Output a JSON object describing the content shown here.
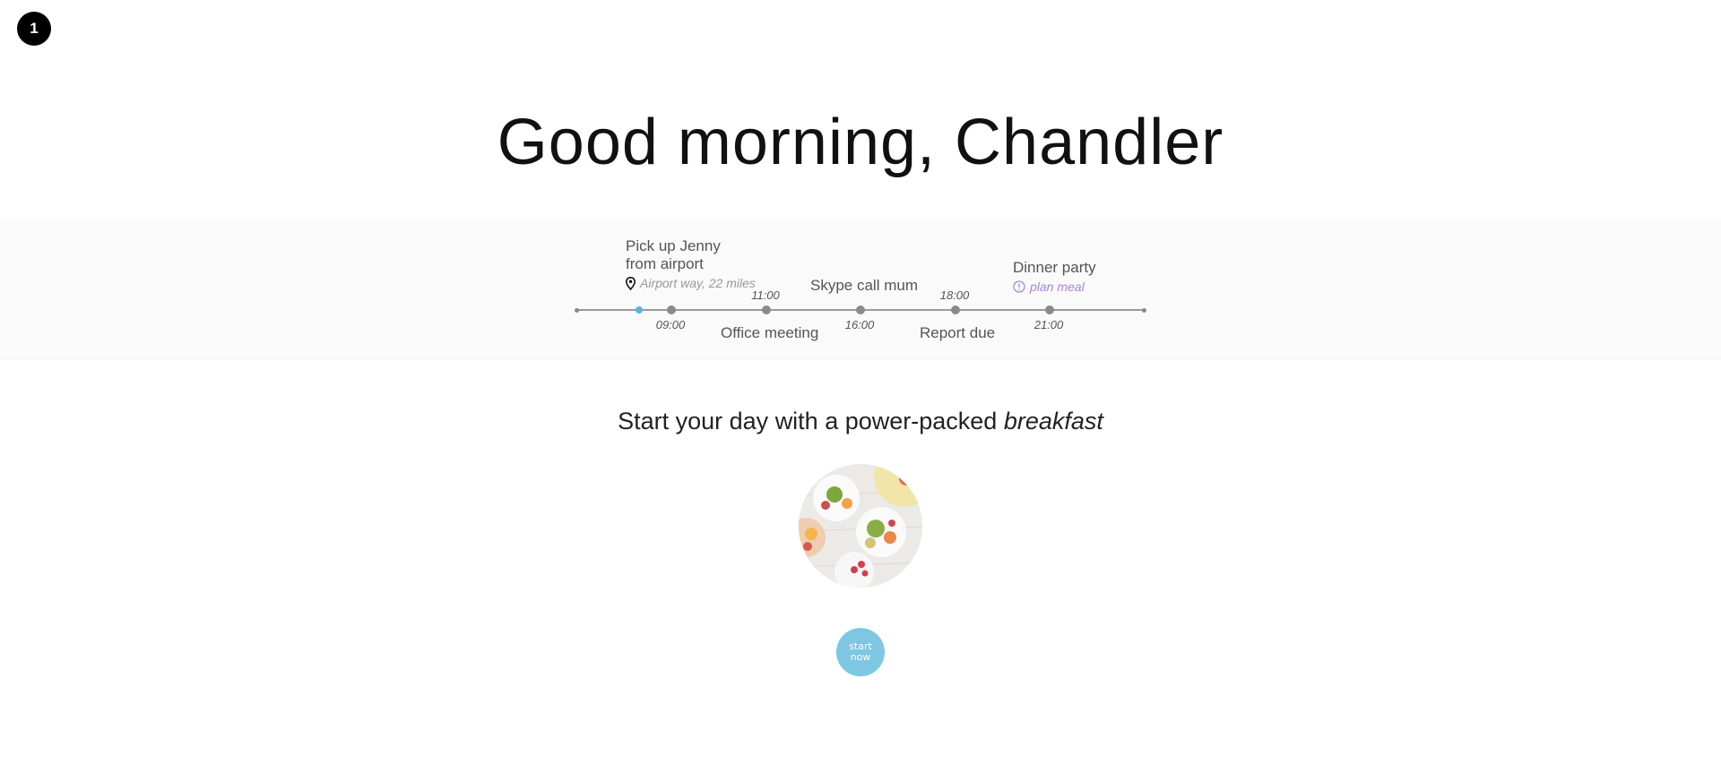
{
  "step_badge": "1",
  "greeting": "Good morning, Chandler",
  "timeline": {
    "times": [
      "09:00",
      "11:00",
      "16:00",
      "18:00",
      "21:00"
    ],
    "events": {
      "pickup_line1": "Pick up Jenny",
      "pickup_line2": "from airport",
      "pickup_location": "Airport way, 22 miles",
      "office": "Office meeting",
      "skype": "Skype call mum",
      "report": "Report due",
      "dinner": "Dinner party",
      "dinner_action": "plan meal"
    },
    "colors": {
      "now_dot": "#5ab4e0",
      "plan_link": "#a685e8"
    }
  },
  "breakfast": {
    "title_prefix": "Start your day with a power-packed ",
    "title_emphasis": "breakfast",
    "button_label": "start now",
    "button_color": "#7ec7e2"
  }
}
